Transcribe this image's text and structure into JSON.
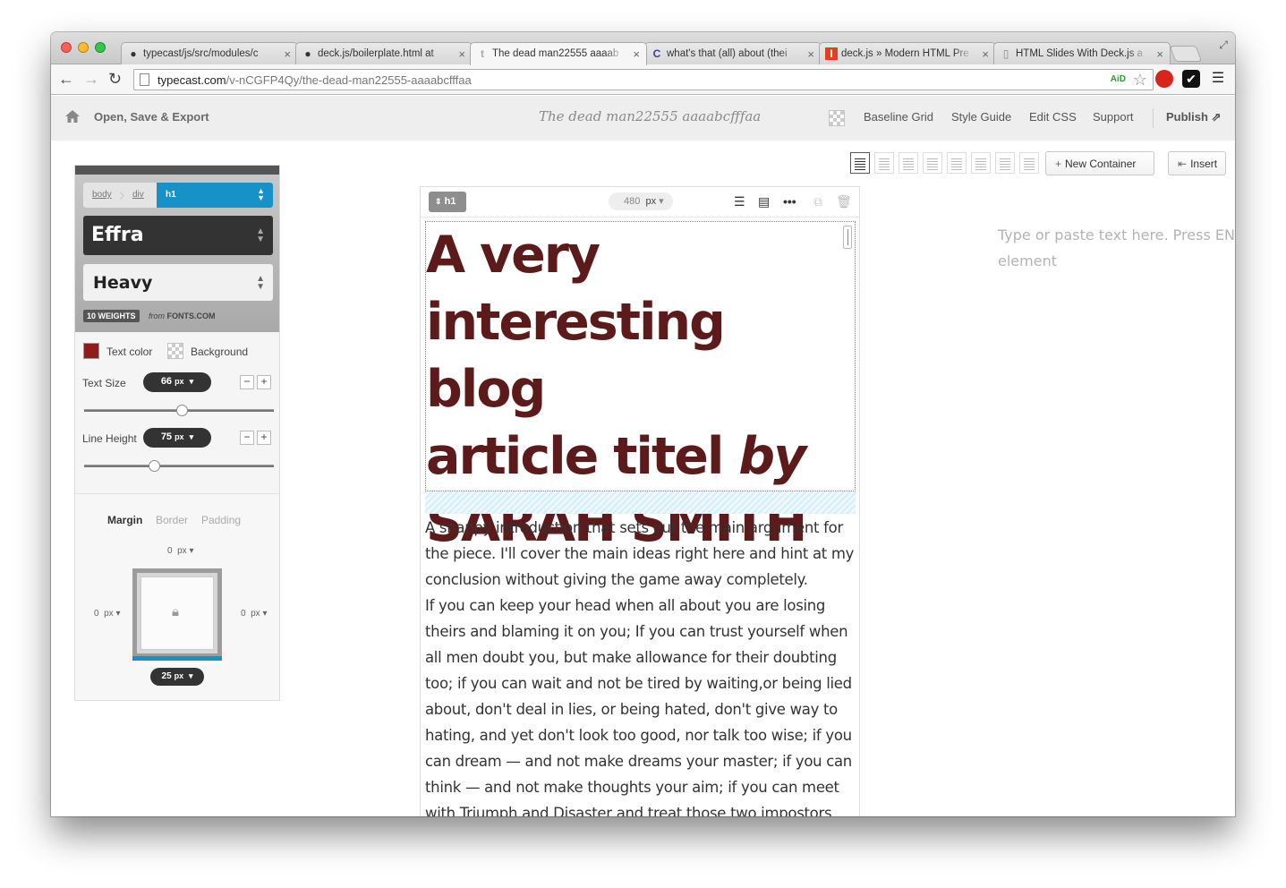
{
  "browser": {
    "tabs": [
      {
        "title": "typecast/js/src/modules/c",
        "icon": "github-icon"
      },
      {
        "title": "deck.js/boilerplate.html at",
        "icon": "github-icon"
      },
      {
        "title": "The dead man22555 aaaab",
        "icon": "typecast-icon"
      },
      {
        "title": "what's that (all) about (thei",
        "icon": "c-icon"
      },
      {
        "title": "deck.js » Modern HTML Pre",
        "icon": "deckjs-icon"
      },
      {
        "title": "HTML Slides With Deck.js a",
        "icon": "page-icon"
      }
    ],
    "url_host": "typecast.com",
    "url_path": "/v-nCGFP4Qy/the-dead-man22555-aaaabcfffaa",
    "aid_label": "AiD"
  },
  "header": {
    "open_save": "Open, Save & Export",
    "doc_title": "The dead man22555 aaaabcfffaa",
    "baseline_grid": "Baseline Grid",
    "style_guide": "Style Guide",
    "edit_css": "Edit CSS",
    "support": "Support",
    "publish": "Publish"
  },
  "actions": {
    "new_container": "New Container",
    "insert": "Insert"
  },
  "panel": {
    "crumbs": [
      "body",
      "div"
    ],
    "crumb_active": "h1",
    "font_family": "Effra",
    "font_weight": "Heavy",
    "weights_badge": "10 WEIGHTS",
    "from_label": "from",
    "from_source": "FONTS.COM",
    "text_color_label": "Text color",
    "background_label": "Background",
    "text_size_label": "Text Size",
    "text_size_value": "66",
    "line_height_label": "Line Height",
    "line_height_value": "75",
    "unit": "px",
    "text_size_slider": 0.52,
    "line_height_slider": 0.36,
    "tabs": [
      "Margin",
      "Border",
      "Padding"
    ],
    "margin_top": "0",
    "margin_left": "0",
    "margin_right": "0",
    "margin_bottom": "25",
    "text_color": "#8f1b1b"
  },
  "editor": {
    "tag": "h1",
    "width_value": "480",
    "width_unit": "px",
    "heading_line1": "A very",
    "heading_line2": "interesting blog",
    "heading_line3a": "article titel ",
    "heading_by": "by",
    "heading_line4": "SARAH SMITH",
    "heading_color": "#5c1a1a",
    "paragraph1": "A snappy introduction that sets out the main argument for the piece. I'll cover the main ideas right here and hint at my conclusion without giving the game away completely.",
    "paragraph2": "If you can keep your head when all about you are losing theirs and blaming it on you; If you can trust yourself when all men doubt you, but make allowance for their doubting too; if you can wait and not be tired by waiting,or being lied about, don't deal in lies, or being hated, don't give way to hating, and yet don't look too good, nor talk too wise; if you can dream — and not make dreams your master; if you can think — and not make thoughts your aim; if you can meet with Triumph and Disaster and treat those two impostors",
    "hint": "Type or paste text here. Press EN",
    "hint_line2": "element"
  }
}
